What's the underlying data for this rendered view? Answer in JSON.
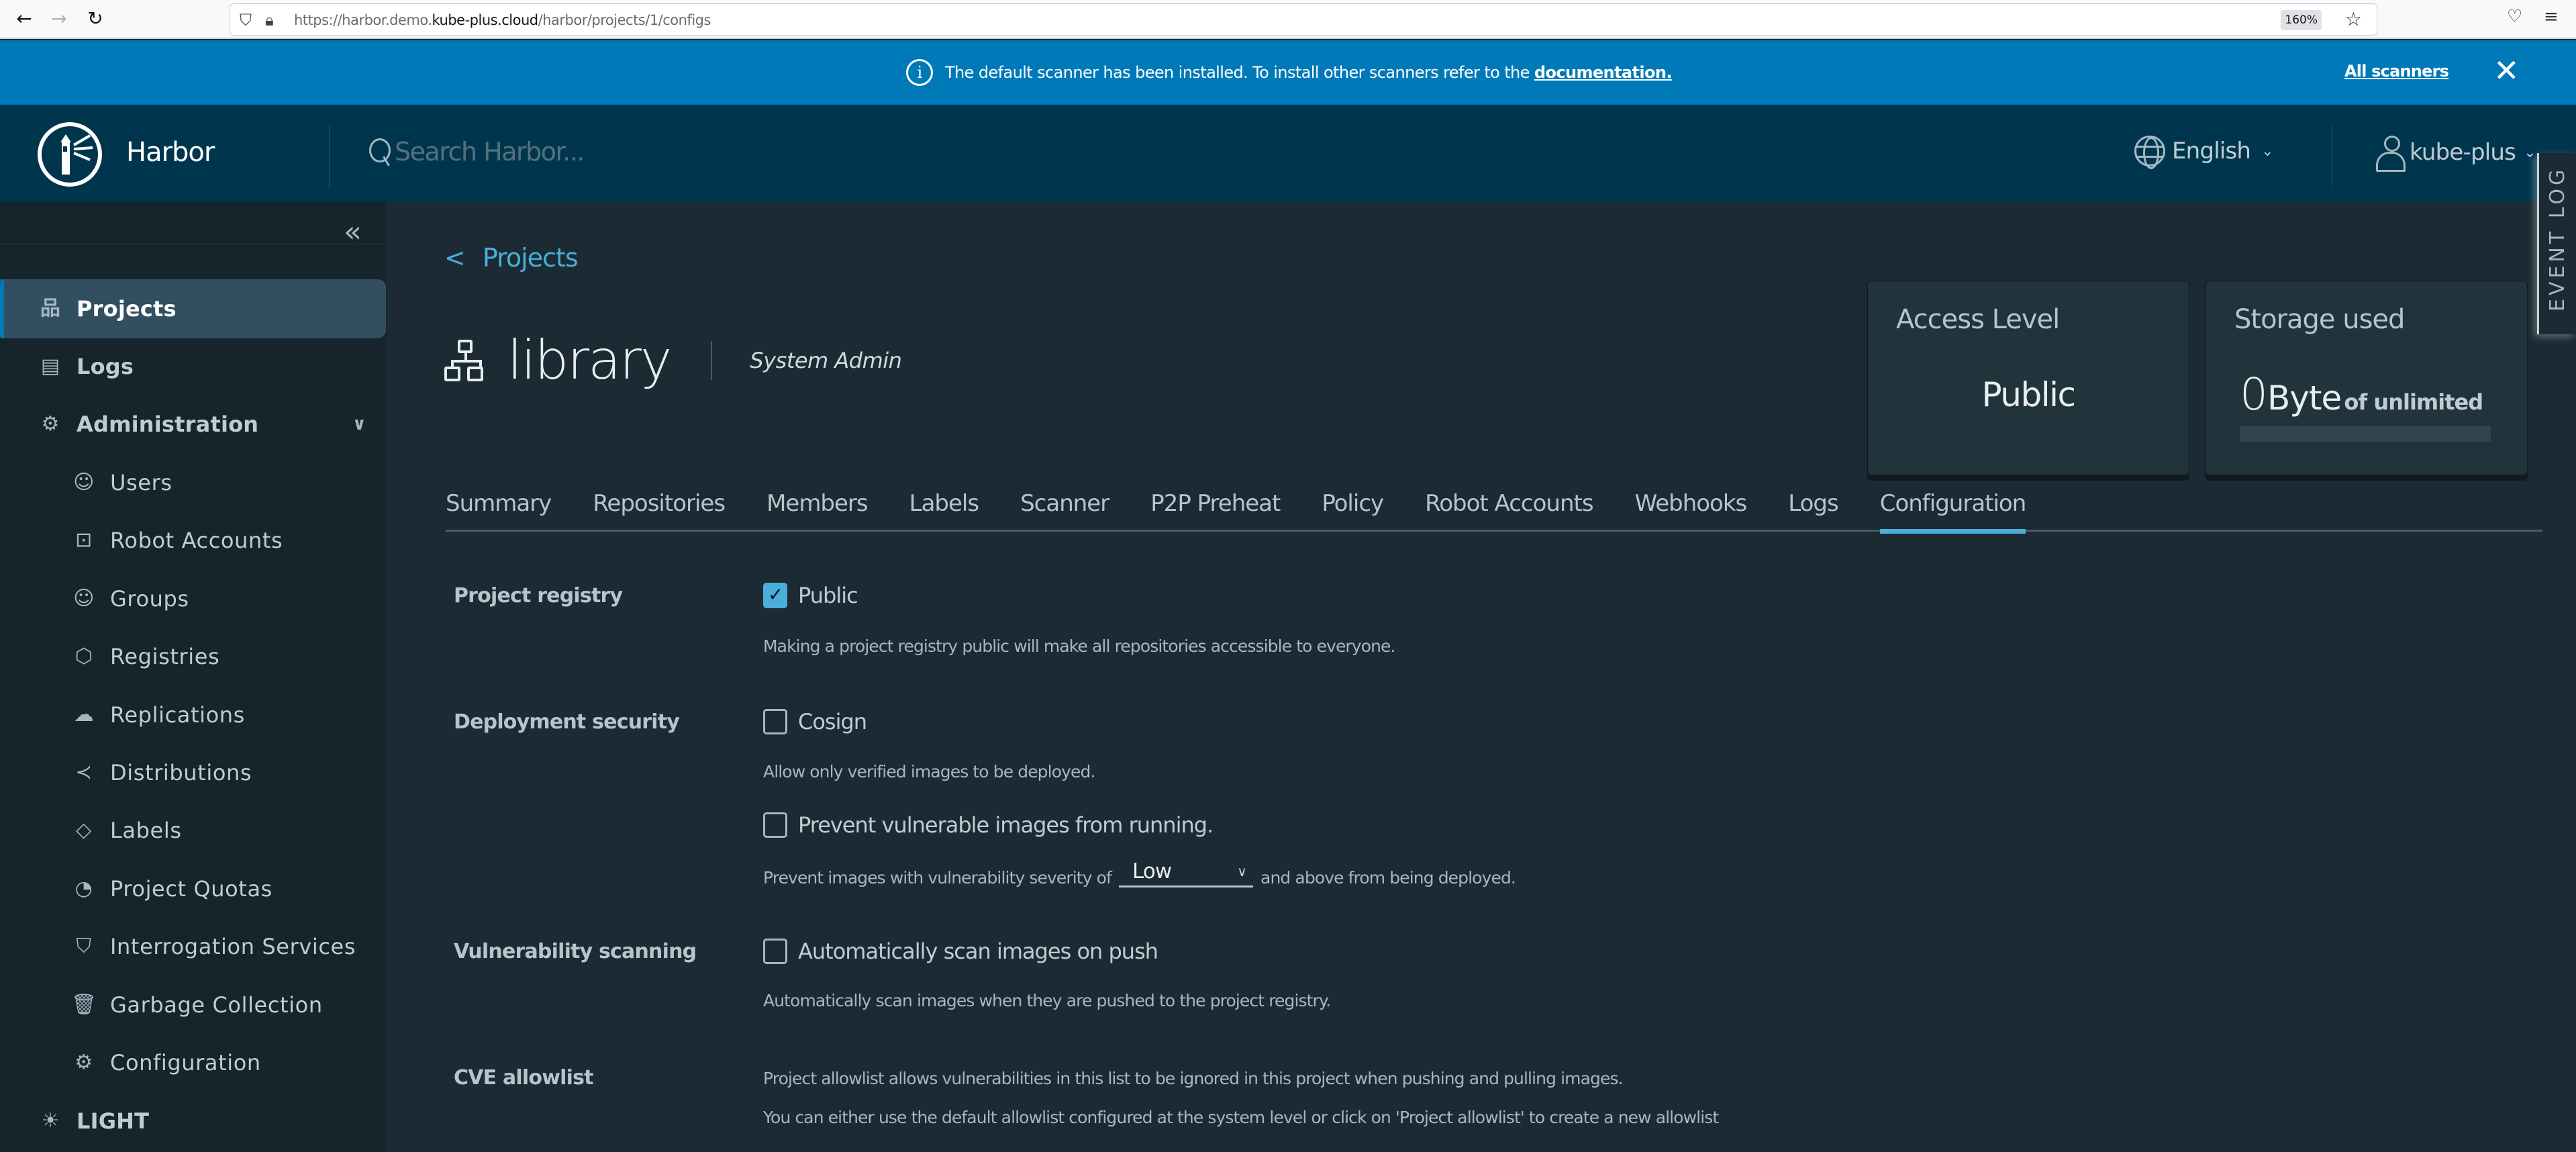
{
  "browser": {
    "url_prefix": "https://harbor.demo.",
    "url_domain": "kube-plus.cloud",
    "url_path": "/harbor/projects/1/configs",
    "zoom": "160%"
  },
  "banner": {
    "message": "The default scanner has been installed. To install other scanners refer to the",
    "link": "documentation.",
    "all_scanners": "All scanners",
    "bg_color": "#0079b8"
  },
  "header": {
    "brand": "Harbor",
    "search_placeholder": "Search Harbor...",
    "language": "English",
    "user": "kube-plus"
  },
  "sidebar": {
    "items": [
      {
        "label": "Projects",
        "icon": "projects-icon",
        "active": true
      },
      {
        "label": "Logs",
        "icon": "logs-icon"
      },
      {
        "label": "Administration",
        "icon": "admin-icon",
        "expanded": true
      },
      {
        "label": "Users",
        "icon": "users-icon"
      },
      {
        "label": "Robot Accounts",
        "icon": "robot-icon"
      },
      {
        "label": "Groups",
        "icon": "groups-icon"
      },
      {
        "label": "Registries",
        "icon": "registries-icon"
      },
      {
        "label": "Replications",
        "icon": "replications-icon"
      },
      {
        "label": "Distributions",
        "icon": "distributions-icon"
      },
      {
        "label": "Labels",
        "icon": "labels-icon"
      },
      {
        "label": "Project Quotas",
        "icon": "quotas-icon"
      },
      {
        "label": "Interrogation Services",
        "icon": "shield-icon"
      },
      {
        "label": "Garbage Collection",
        "icon": "trash-icon"
      },
      {
        "label": "Configuration",
        "icon": "gear-icon"
      }
    ],
    "theme_toggle": "LIGHT"
  },
  "main": {
    "breadcrumb_back": "<",
    "breadcrumb": "Projects",
    "project_name": "library",
    "role": "System Admin",
    "access_card": {
      "title": "Access Level",
      "value": "Public"
    },
    "storage_card": {
      "title": "Storage used",
      "value": "0",
      "unit": "Byte",
      "of_label": "of unlimited",
      "usage_percent": 0
    },
    "event_log": "EVENT LOG",
    "tabs": [
      "Summary",
      "Repositories",
      "Members",
      "Labels",
      "Scanner",
      "P2P Preheat",
      "Policy",
      "Robot Accounts",
      "Webhooks",
      "Logs",
      "Configuration"
    ],
    "active_tab": "Configuration",
    "config": {
      "project_registry": {
        "label": "Project registry",
        "checkbox": "Public",
        "checked": true,
        "help": "Making a project registry public will make all repositories accessible to everyone."
      },
      "deployment_security": {
        "label": "Deployment security",
        "cosign": "Cosign",
        "cosign_checked": false,
        "cosign_help": "Allow only verified images to be deployed.",
        "prevent": "Prevent vulnerable images from running.",
        "prevent_checked": false,
        "severity_prefix": "Prevent images with vulnerability severity of",
        "severity_value": "Low",
        "severity_suffix": "and above from being deployed."
      },
      "vulnerability_scanning": {
        "label": "Vulnerability scanning",
        "checkbox": "Automatically scan images on push",
        "checked": false,
        "help": "Automatically scan images when they are pushed to the project registry."
      },
      "cve_allowlist": {
        "label": "CVE allowlist",
        "line1": "Project allowlist allows vulnerabilities in this list to be ignored in this project when pushing and pulling images.",
        "line2": "You can either use the default allowlist configured at the system level or click on 'Project allowlist' to create a new allowlist"
      }
    }
  }
}
